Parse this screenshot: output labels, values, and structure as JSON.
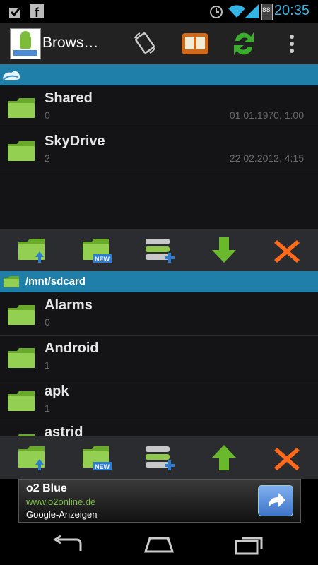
{
  "status_bar": {
    "time": "20:35",
    "battery": "88"
  },
  "action_bar": {
    "title": "Brows…",
    "logo_text": "Browse to SkyDrive"
  },
  "skydrive_panel": {
    "items": [
      {
        "name": "Shared",
        "count": "0",
        "date": "01.01.1970, 1:00"
      },
      {
        "name": "SkyDrive",
        "count": "2",
        "date": "22.02.2012, 4:15"
      }
    ]
  },
  "local_panel": {
    "path": "/mnt/sdcard",
    "items": [
      {
        "name": "Alarms",
        "count": "0"
      },
      {
        "name": "Android",
        "count": "1"
      },
      {
        "name": "apk",
        "count": "1"
      },
      {
        "name": "astrid",
        "count": ""
      }
    ]
  },
  "ad": {
    "title": "o2 Blue",
    "url": "www.o2online.de",
    "source": "Google-Anzeigen"
  },
  "colors": {
    "section": "#1f7fa8",
    "folder": "#7cbc3a",
    "accent_time": "#33b5e5",
    "delete": "#ff6a1a"
  }
}
